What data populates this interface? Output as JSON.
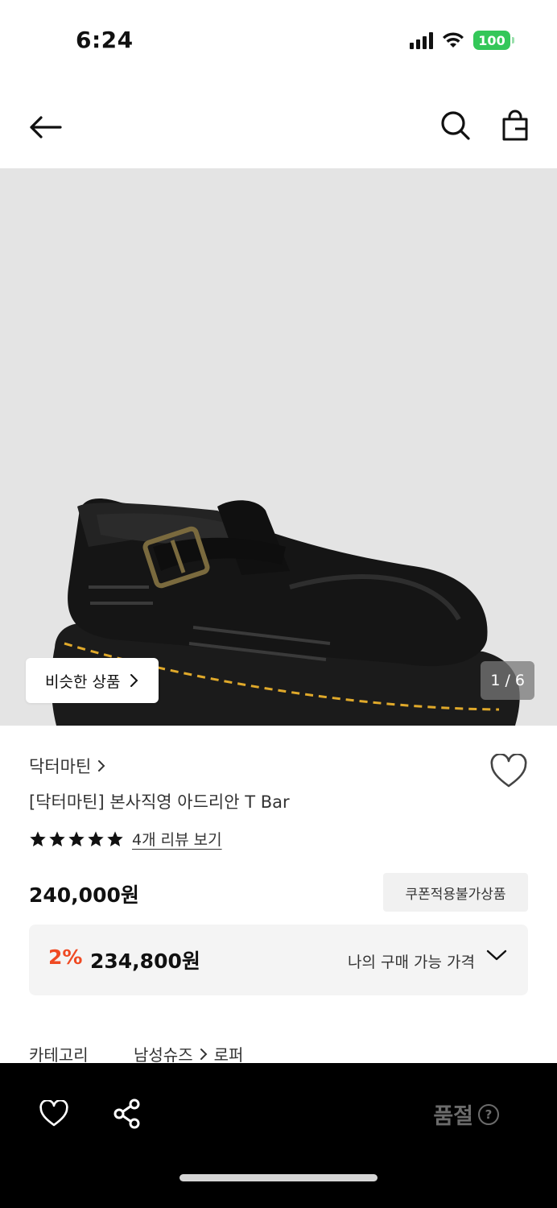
{
  "status_bar": {
    "time": "6:24",
    "battery": "100",
    "battery_color": "#34c759"
  },
  "header": {
    "back_icon": "arrow-left-icon",
    "search_icon": "search-icon",
    "bag_icon": "shopping-bag-icon"
  },
  "gallery": {
    "similar_button": "비슷한 상품",
    "page_indicator": "1 / 6",
    "background": "#e4e4e4"
  },
  "product": {
    "brand": "닥터마틴",
    "name": "[닥터마틴] 본사직영 아드리안 T Bar",
    "stars": 5,
    "review_link": "4개 리뷰 보기",
    "price": "240,000원",
    "coupon_badge": "쿠폰적용불가상품",
    "discount_rate": "2%",
    "discount_price": "234,800원",
    "my_price_label": "나의 구매 가능 가격",
    "discount_color": "#ef4a23"
  },
  "category": {
    "label": "카테고리",
    "path_1": "남성슈즈",
    "path_2": "로퍼"
  },
  "bottom_bar": {
    "soldout": "품절",
    "help": "?"
  }
}
